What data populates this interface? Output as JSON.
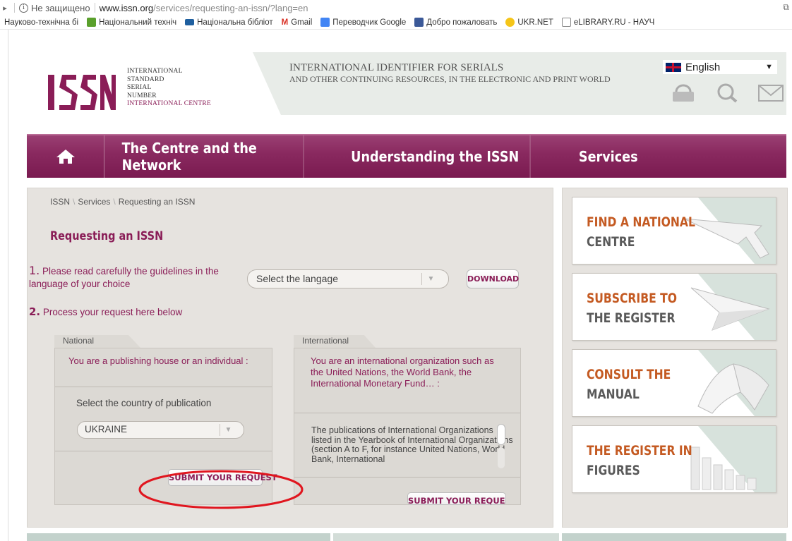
{
  "browser": {
    "security_label": "Не защищено",
    "url_host": "www.issn.org",
    "url_path": "/services/requesting-an-issn/?lang=en",
    "bookmarks": [
      {
        "label": "Науково-технічна бі",
        "icon": "folder-icon",
        "color": "#ffffff"
      },
      {
        "label": "Національний техніч",
        "icon": "flag-icon",
        "color": "#5aa02c"
      },
      {
        "label": "Національна бібліот",
        "icon": "library-icon",
        "color": "#1f5f9f"
      },
      {
        "label": "Gmail",
        "icon": "gmail-icon",
        "color": "#d93025"
      },
      {
        "label": "Переводчик Google",
        "icon": "translate-icon",
        "color": "#4285f4"
      },
      {
        "label": "Добро пожаловать",
        "icon": "facebook-icon",
        "color": "#3b5998"
      },
      {
        "label": "UKR.NET",
        "icon": "ukrnet-icon",
        "color": "#f5c518"
      },
      {
        "label": "eLIBRARY.RU - НАУЧ",
        "icon": "page-icon",
        "color": "#ffffff"
      }
    ]
  },
  "header": {
    "logo_letters": "ISSN",
    "logo_lines": [
      "INTERNATIONAL",
      "STANDARD",
      "SERIAL",
      "NUMBER"
    ],
    "logo_centre": "INTERNATIONAL CENTRE",
    "tagline_1": "INTERNATIONAL IDENTIFIER FOR SERIALS",
    "tagline_2": "AND OTHER CONTINUING RESOURCES, IN THE ELECTRONIC AND PRINT WORLD",
    "language": "English",
    "icons": [
      "lock-icon",
      "search-icon",
      "mail-icon"
    ]
  },
  "nav": {
    "home_icon": "home-icon",
    "items": [
      "The Centre and the Network",
      "Understanding the ISSN",
      "Services"
    ]
  },
  "main": {
    "breadcrumb": [
      "ISSN",
      "Services",
      "Requesting an ISSN"
    ],
    "title": "Requesting an ISSN",
    "step1_num": "1.",
    "step1_text": "Please read carefully the guidelines in the language of your choice",
    "lang_placeholder": "Select the langage",
    "download_label": "DOWNLOAD",
    "step2_num": "2.",
    "step2_text": "Process your request here below",
    "national": {
      "tab": "National",
      "intro": "You are a publishing house or an individual :",
      "select_label": "Select the country of publication",
      "country": "UKRAINE",
      "submit": "SUBMIT YOUR REQUEST"
    },
    "international": {
      "tab": "International",
      "intro": "You are an international organization such as the United Nations, the World Bank, the International Monetary Fund… :",
      "scroll_text": "The publications of International Organizations listed in the Yearbook of International Organizations (section A to F, for instance United Nations, World Bank, International",
      "submit": "SUBMIT YOUR REQUEST"
    }
  },
  "sidebar": {
    "cards": [
      {
        "line1": "FIND A NATIONAL",
        "line2": "CENTRE",
        "icon": "cursor-arrow-icon"
      },
      {
        "line1": "SUBSCRIBE TO",
        "line2": "THE REGISTER",
        "icon": "paper-plane-icon"
      },
      {
        "line1": "CONSULT THE",
        "line2": "MANUAL",
        "icon": "open-book-icon"
      },
      {
        "line1": "THE REGISTER IN",
        "line2": "FIGURES",
        "icon": "bar-chart-icon"
      }
    ]
  },
  "colors": {
    "brand": "#8a1d57",
    "card_orange": "#c45a22",
    "annotation": "#e0161f"
  }
}
